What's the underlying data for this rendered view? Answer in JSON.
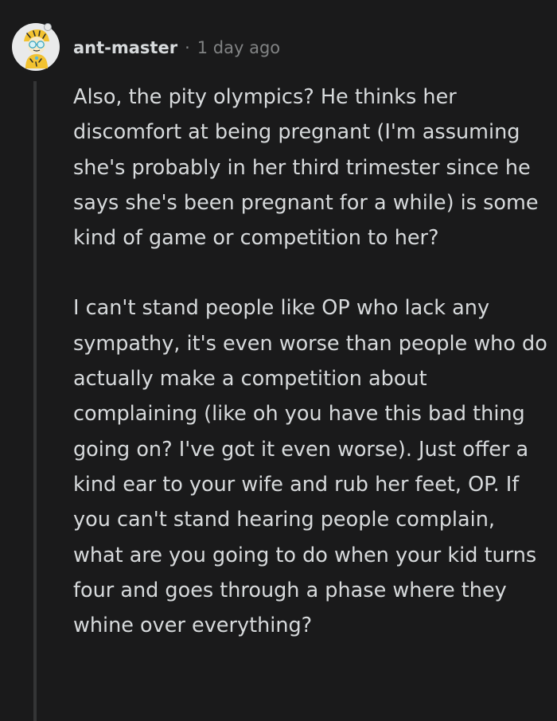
{
  "comment": {
    "avatar_icon": "snoo-avatar-icon",
    "username": "ant-master",
    "separator": "·",
    "timestamp": "1 day ago",
    "paragraphs": [
      "Also, the pity olympics? He thinks her discomfort at being pregnant (I'm assuming she's probably in her third trimester since he says she's been pregnant for a while) is some kind of game or competition to her?",
      "I can't stand people like OP who lack any sympathy, it's even worse than people who do actually make a competition about complaining (like oh you have this bad thing going on? I've got it even worse). Just offer a kind ear to your wife and rub her feet, OP. If you can't stand hearing people complain, what are you going to do when your kid turns four and goes through a phase where they whine over everything?"
    ]
  },
  "colors": {
    "background": "#1a1a1b",
    "text": "#d7dadc",
    "muted": "#818384",
    "thread_line": "#343536"
  }
}
